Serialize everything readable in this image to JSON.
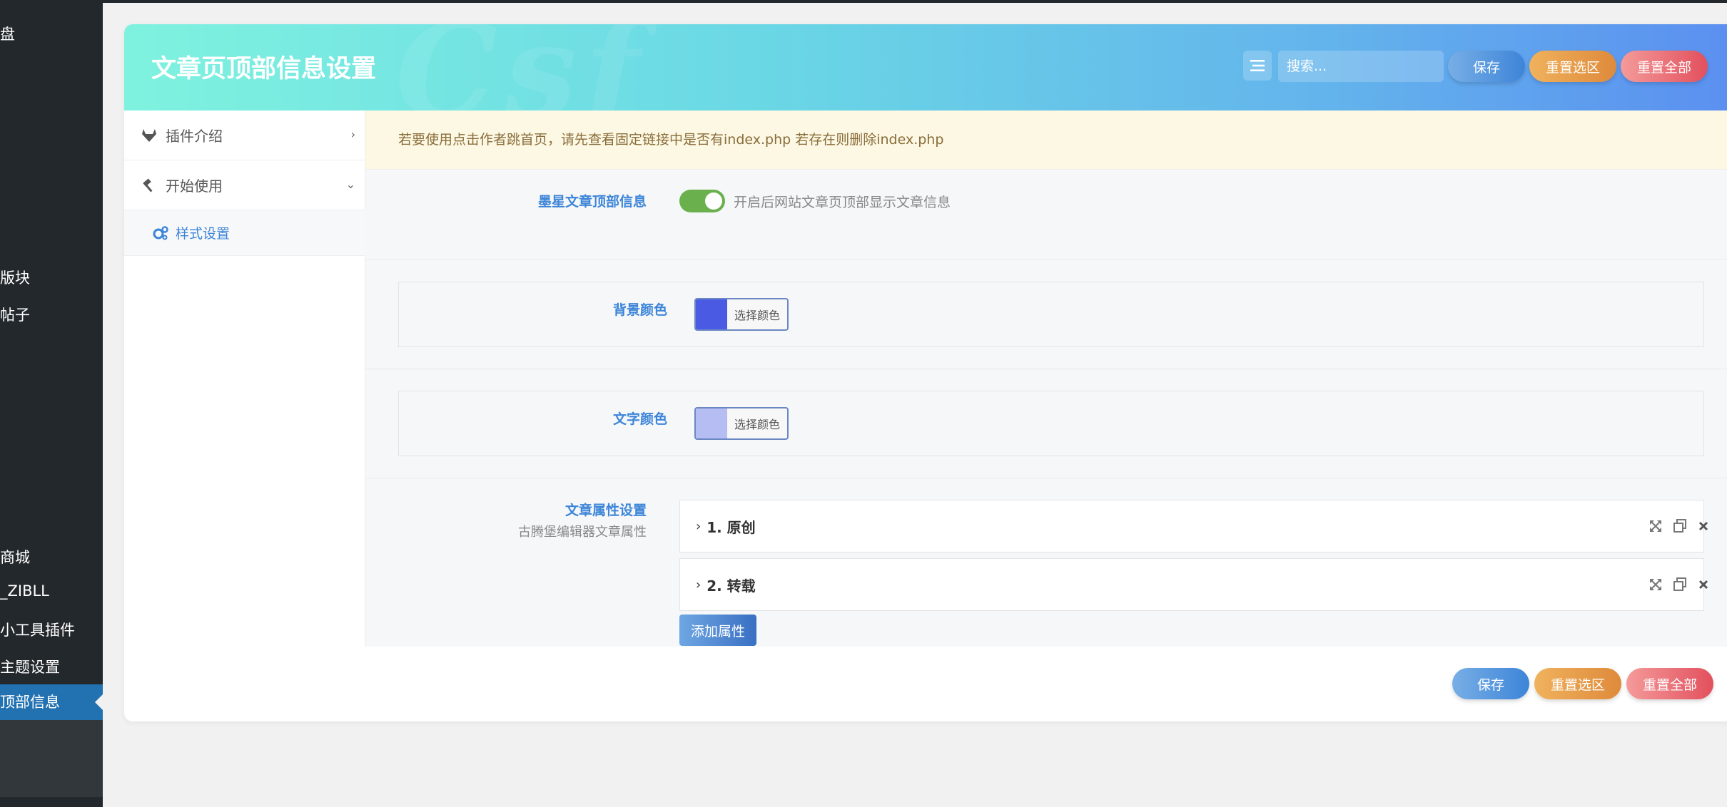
{
  "admin_menu": {
    "items": [
      "盘",
      "版块",
      "帖子",
      "商城",
      "_ZIBLL",
      "小工具插件",
      "主题设置",
      "顶部信息"
    ]
  },
  "header": {
    "title": "文章页顶部信息设置",
    "search_placeholder": "搜索...",
    "save": "保存",
    "reset_section": "重置选区",
    "reset_all": "重置全部"
  },
  "nav": {
    "items": [
      {
        "label": "插件介绍",
        "icon": "gitlab-icon",
        "chevron": "›"
      },
      {
        "label": "开始使用",
        "icon": "hammer-icon",
        "chevron": "⌄"
      }
    ],
    "sub_items": [
      {
        "label": "样式设置",
        "icon": "cogs-icon"
      }
    ]
  },
  "content": {
    "notice": "若要使用点击作者跳首页，请先查看固定链接中是否有index.php 若存在则删除index.php",
    "fields": {
      "enable": {
        "title": "墨星文章顶部信息",
        "desc": "开启后网站文章页顶部显示文章信息",
        "value": true
      },
      "bg_color": {
        "title": "背景颜色",
        "button": "选择颜色",
        "value": "#4a5ae3"
      },
      "text_color": {
        "title": "文字颜色",
        "button": "选择颜色",
        "value": "#b5bdf2"
      },
      "attributes": {
        "title": "文章属性设置",
        "desc": "古腾堡编辑器文章属性",
        "groups": [
          {
            "title": "1. 原创"
          },
          {
            "title": "2. 转载"
          }
        ],
        "add_button": "添加属性"
      }
    }
  },
  "footer": {
    "save": "保存",
    "reset_section": "重置选区",
    "reset_all": "重置全部"
  }
}
